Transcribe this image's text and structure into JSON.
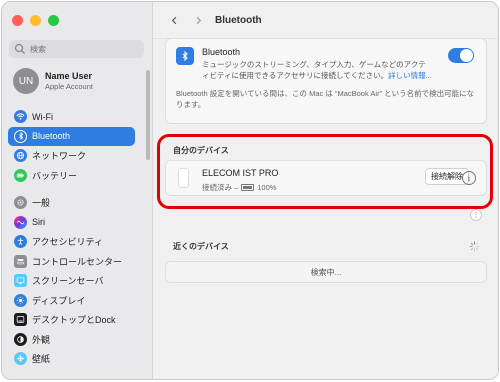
{
  "window": {
    "traffic_lights": [
      "#ff5f57",
      "#febc2e",
      "#28c840"
    ]
  },
  "sidebar": {
    "search_placeholder": "検索",
    "account": {
      "initials": "UN",
      "name": "Name User",
      "subtitle": "Apple Account"
    },
    "items": [
      {
        "label": "Wi-Fi",
        "icon": "wifi-icon",
        "color": "#2f7de1"
      },
      {
        "label": "Bluetooth",
        "icon": "bluetooth-icon",
        "color": "#2f7de1",
        "selected": true
      },
      {
        "label": "ネットワーク",
        "icon": "globe-icon",
        "color": "#2f7de1"
      },
      {
        "label": "バッテリー",
        "icon": "battery-icon",
        "color": "#34c759"
      },
      {
        "label": "一般",
        "icon": "gear-icon",
        "color": "#8e8e93"
      },
      {
        "label": "Siri",
        "icon": "siri-icon",
        "color": "#6e3bd8"
      },
      {
        "label": "アクセシビリティ",
        "icon": "accessibility-icon",
        "color": "#2f7de1"
      },
      {
        "label": "コントロールセンター",
        "icon": "control-center-icon",
        "color": "#8e8e93"
      },
      {
        "label": "スクリーンセーバ",
        "icon": "screensaver-icon",
        "color": "#5ac8fa"
      },
      {
        "label": "ディスプレイ",
        "icon": "display-icon",
        "color": "#2f7de1"
      },
      {
        "label": "デスクトップとDock",
        "icon": "dock-icon",
        "color": "#1c1c1e"
      },
      {
        "label": "外観",
        "icon": "appearance-icon",
        "color": "#1c1c1e"
      },
      {
        "label": "壁紙",
        "icon": "wallpaper-icon",
        "color": "#5ac8fa"
      }
    ]
  },
  "main": {
    "title": "Bluetooth",
    "bluetooth": {
      "title": "Bluetooth",
      "description": "ミュージックのストリーミング、タイプ入力、ゲームなどのアクティビティに使用できるアクセサリに接続してください。",
      "link": "詳しい情報...",
      "enabled": true,
      "note": "Bluetooth 設定を開いている間は、この Mac は “MacBook Air” という名前で検出可能になります。"
    },
    "my_devices": {
      "title": "自分のデバイス",
      "device_name": "ELECOM IST PRO",
      "status": "接続済み –",
      "battery": "100%",
      "disconnect_label": "接続解除"
    },
    "nearby": {
      "title": "近くのデバイス",
      "searching": "検索中..."
    },
    "accent": "#2f7de1",
    "highlight_color": "#e30000"
  }
}
